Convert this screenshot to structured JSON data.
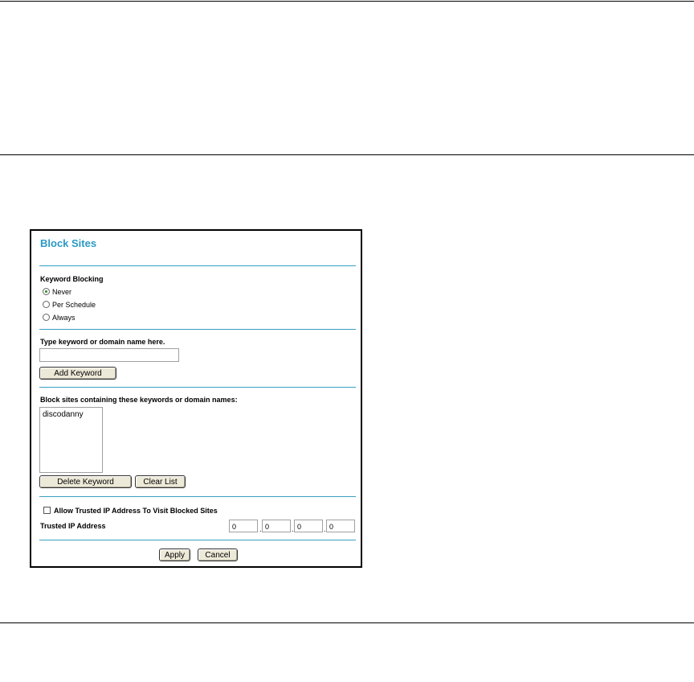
{
  "window": {
    "title": "Block Sites"
  },
  "keyword_blocking": {
    "label": "Keyword Blocking",
    "options": [
      {
        "label": "Never",
        "selected": true
      },
      {
        "label": "Per Schedule",
        "selected": false
      },
      {
        "label": "Always",
        "selected": false
      }
    ]
  },
  "keyword_entry": {
    "label": "Type keyword or domain name here.",
    "value": "",
    "add_button": "Add Keyword"
  },
  "blocked_list": {
    "label": "Block sites containing these keywords or domain names:",
    "items": [
      "discodanny"
    ],
    "delete_button": "Delete Keyword",
    "clear_button": "Clear List"
  },
  "trusted": {
    "checkbox_label": "Allow Trusted IP Address To Visit Blocked Sites",
    "checked": false,
    "ip_label": "Trusted IP Address",
    "ip_octets": [
      "0",
      "0",
      "0",
      "0"
    ],
    "separator": "."
  },
  "actions": {
    "apply": "Apply",
    "cancel": "Cancel"
  }
}
